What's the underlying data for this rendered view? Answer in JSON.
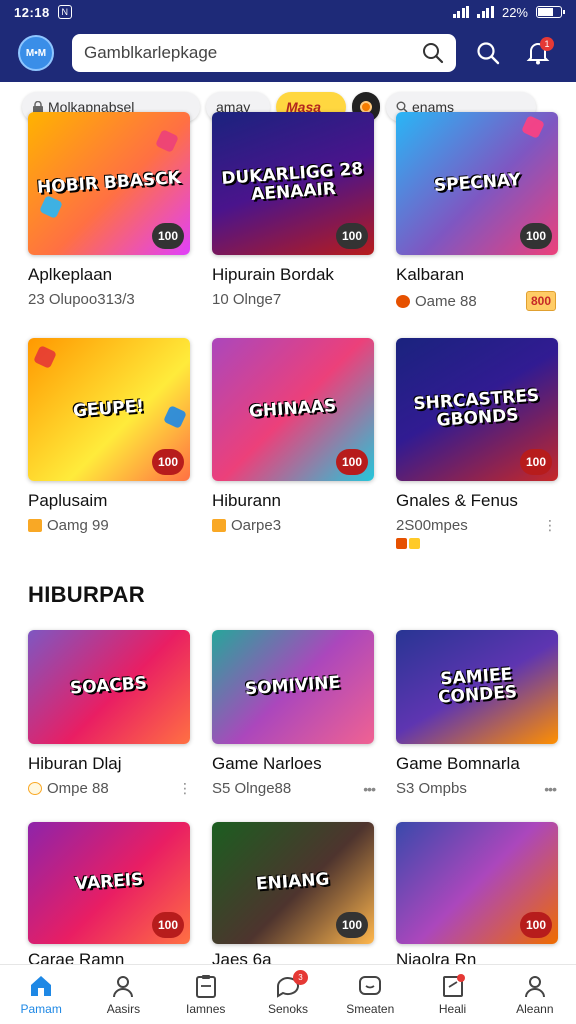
{
  "status": {
    "time": "12:18",
    "battery_label": "22%"
  },
  "header": {
    "logo_text": "M•M",
    "search_placeholder": "Gamblkarlepkage",
    "notification_count": "1"
  },
  "chips": [
    {
      "label": "Molkapnabsel"
    },
    {
      "label": "amay"
    },
    {
      "label": "Masa"
    },
    {
      "label": ""
    },
    {
      "label": "enams"
    }
  ],
  "row1": [
    {
      "art": "HOBIR BBASCK",
      "badge": "100",
      "title": "Aplkeplaan",
      "meta": "23 Olupoo313/3",
      "colors": [
        "#ffb300",
        "#e040fb"
      ],
      "badge_color": "#333"
    },
    {
      "art": "DUKARLIGG 28 AENAAIR",
      "badge": "100",
      "title": "Hipurain Bordak",
      "meta": "10 Olnge7",
      "colors": [
        "#1a237e",
        "#b71c1c"
      ],
      "badge_color": "#333"
    },
    {
      "art": "SPECNAY",
      "badge": "100",
      "title": "Kalbaran",
      "meta": "Oame 88",
      "tag": "800",
      "colors": [
        "#29b6f6",
        "#ec407a"
      ],
      "badge_color": "#333"
    }
  ],
  "row2": [
    {
      "art": "GEUPE!",
      "badge": "100",
      "title": "Paplusaim",
      "meta": "Oamg 99",
      "colors": [
        "#ff9800",
        "#ffeb3b"
      ],
      "badge_color": "#b71c1c"
    },
    {
      "art": "GHINAAS",
      "badge": "100",
      "title": "Hiburann",
      "meta": "Oarpe3",
      "colors": [
        "#ab47bc",
        "#26c6da"
      ],
      "badge_color": "#b71c1c"
    },
    {
      "art": "SHRCASTRES GBONDS",
      "badge": "100",
      "title": "Gnales & Fenus",
      "meta": "2S00mpes",
      "colors": [
        "#1a237e",
        "#c62828"
      ],
      "badge_color": "#b71c1c"
    }
  ],
  "section_title": "HIBURPAR",
  "row3": [
    {
      "art": "SOACBS",
      "title": "Hiburan Dlaj",
      "meta": "Ompe 88",
      "colors": [
        "#7e57c2",
        "#ff7043"
      ]
    },
    {
      "art": "SOMIVINE",
      "title": "Game Narloes",
      "meta": "S5 Olnge88",
      "colors": [
        "#26a69a",
        "#f06292"
      ]
    },
    {
      "art": "SAMIEE CONDES",
      "title": "Game Bomnarla",
      "meta": "S3 Ompbs",
      "colors": [
        "#283593",
        "#ff8f00"
      ]
    }
  ],
  "row4": [
    {
      "art": "VAREIS",
      "badge": "100",
      "title": "Carae Ramn",
      "colors": [
        "#8e24aa",
        "#ff7043"
      ],
      "badge_color": "#b71c1c"
    },
    {
      "art": "ENIANG",
      "badge": "100",
      "title": "Jaes 6a",
      "colors": [
        "#1b5e20",
        "#ffb74d"
      ],
      "badge_color": "#333"
    },
    {
      "art": "",
      "badge": "100",
      "title": "Niaolra Rn",
      "colors": [
        "#3949ab",
        "#ef6c00"
      ],
      "badge_color": "#b71c1c"
    }
  ],
  "nav": [
    {
      "label": "Pamam",
      "active": true
    },
    {
      "label": "Aasirs"
    },
    {
      "label": "Iamnes"
    },
    {
      "label": "Senoks",
      "badge": "3"
    },
    {
      "label": "Smeaten"
    },
    {
      "label": "Heali"
    },
    {
      "label": "Aleann"
    }
  ]
}
